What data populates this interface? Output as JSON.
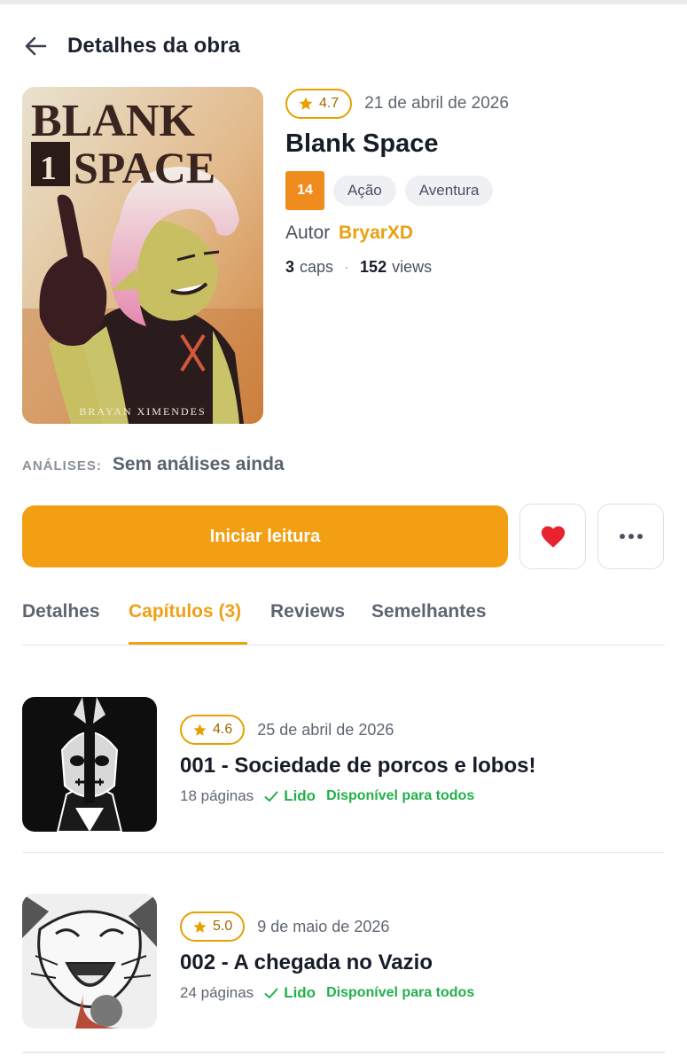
{
  "header": {
    "title": "Detalhes da obra"
  },
  "work": {
    "rating": "4.7",
    "date": "21 de abril de 2026",
    "title": "Blank Space",
    "age_rating": "14",
    "genres": [
      "Ação",
      "Aventura"
    ],
    "author_label": "Autor",
    "author_name": "BryarXD",
    "chapters_count": "3",
    "chapters_unit": "caps",
    "views_count": "152",
    "views_unit": "views",
    "cover": {
      "title_line1": "BLANK",
      "volume": "1",
      "title_line2": "SPACE",
      "artist": "BRAYAN XIMENDES"
    }
  },
  "analyses": {
    "label": "ANÁLISES:",
    "value": "Sem análises ainda"
  },
  "actions": {
    "read_label": "Iniciar leitura",
    "favorite_icon": "heart-icon",
    "more_icon": "more-dots-icon"
  },
  "tabs": [
    {
      "label": "Detalhes",
      "active": false
    },
    {
      "label": "Capítulos (3)",
      "active": true
    },
    {
      "label": "Reviews",
      "active": false
    },
    {
      "label": "Semelhantes",
      "active": false
    }
  ],
  "chapters": [
    {
      "rating": "4.6",
      "date": "25 de abril de 2026",
      "title": "001 - Sociedade de porcos e lobos!",
      "pages": "18 páginas",
      "read_status": "Lido",
      "availability": "Disponível para todos"
    },
    {
      "rating": "5.0",
      "date": "9 de maio de 2026",
      "title": "002 - A chegada no Vazio",
      "pages": "24 páginas",
      "read_status": "Lido",
      "availability": "Disponível para todos"
    }
  ],
  "colors": {
    "accent": "#f39f13",
    "rating_border": "#e6a000",
    "age_badge": "#f08b1d",
    "success": "#22b04b",
    "heart": "#e8232f"
  }
}
